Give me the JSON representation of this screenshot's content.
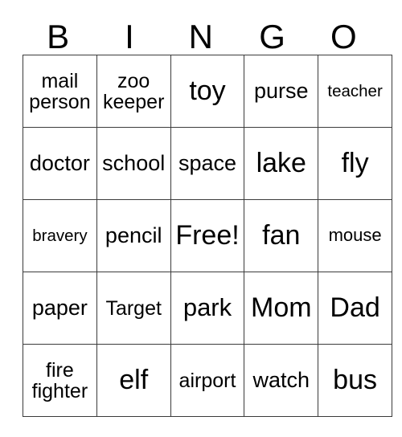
{
  "card": {
    "title_letters": [
      "B",
      "I",
      "N",
      "G",
      "O"
    ],
    "free_space_label": "Free!",
    "rows": [
      [
        {
          "text": "mail\nperson",
          "size": "two"
        },
        {
          "text": "zoo\nkeeper",
          "size": "two"
        },
        {
          "text": "toy",
          "size": "xl"
        },
        {
          "text": "purse",
          "size": "md"
        },
        {
          "text": "teacher",
          "size": "xxs"
        }
      ],
      [
        {
          "text": "doctor",
          "size": "md"
        },
        {
          "text": "school",
          "size": "md"
        },
        {
          "text": "space",
          "size": "md"
        },
        {
          "text": "lake",
          "size": "xl"
        },
        {
          "text": "fly",
          "size": "xl"
        }
      ],
      [
        {
          "text": "bravery",
          "size": "xxs"
        },
        {
          "text": "pencil",
          "size": "md"
        },
        {
          "text": "Free!",
          "size": "xl"
        },
        {
          "text": "fan",
          "size": "xl"
        },
        {
          "text": "mouse",
          "size": "xs"
        }
      ],
      [
        {
          "text": "paper",
          "size": "md"
        },
        {
          "text": "Target",
          "size": "sm"
        },
        {
          "text": "park",
          "size": "lg"
        },
        {
          "text": "Mom",
          "size": "xl"
        },
        {
          "text": "Dad",
          "size": "xl"
        }
      ],
      [
        {
          "text": "fire\nfighter",
          "size": "two"
        },
        {
          "text": "elf",
          "size": "xl"
        },
        {
          "text": "airport",
          "size": "sm"
        },
        {
          "text": "watch",
          "size": "md"
        },
        {
          "text": "bus",
          "size": "xl"
        }
      ]
    ]
  },
  "colors": {
    "text": "#000000",
    "border": "#3b3b3b",
    "background": "#ffffff"
  }
}
